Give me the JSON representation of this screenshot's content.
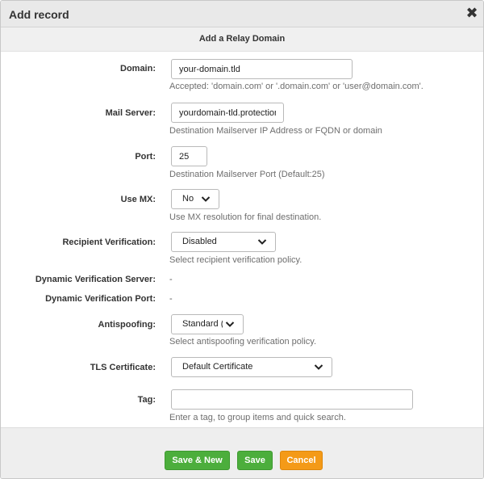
{
  "dialog": {
    "title": "Add record",
    "section_title": "Add a Relay Domain"
  },
  "form": {
    "domain": {
      "label": "Domain:",
      "value": "your-domain.tld",
      "help": "Accepted: 'domain.com' or '.domain.com' or 'user@domain.com'."
    },
    "mail_server": {
      "label": "Mail Server:",
      "value": "yourdomain-tld.protection",
      "help": "Destination Mailserver IP Address or FQDN or domain"
    },
    "port": {
      "label": "Port:",
      "value": "25",
      "help": "Destination Mailserver Port (Default:25)"
    },
    "use_mx": {
      "label": "Use MX:",
      "selected": "No",
      "help": "Use MX resolution for final destination."
    },
    "recipient_verification": {
      "label": "Recipient Verification:",
      "selected": "Disabled",
      "help": "Select recipient verification policy."
    },
    "dynamic_verification_server": {
      "label": "Dynamic Verification Server:",
      "value": "-"
    },
    "dynamic_verification_port": {
      "label": "Dynamic Verification Port:",
      "value": "-"
    },
    "antispoofing": {
      "label": "Antispoofing:",
      "selected": "Standard (",
      "help": "Select antispoofing verification policy."
    },
    "tls_certificate": {
      "label": "TLS Certificate:",
      "selected": "Default Certificate"
    },
    "tag": {
      "label": "Tag:",
      "value": "",
      "help": "Enter a tag, to group items and quick search."
    }
  },
  "buttons": {
    "save_new": "Save & New",
    "save": "Save",
    "cancel": "Cancel"
  },
  "colors": {
    "save_green": "#4cae3c",
    "cancel_orange": "#f49a17"
  }
}
